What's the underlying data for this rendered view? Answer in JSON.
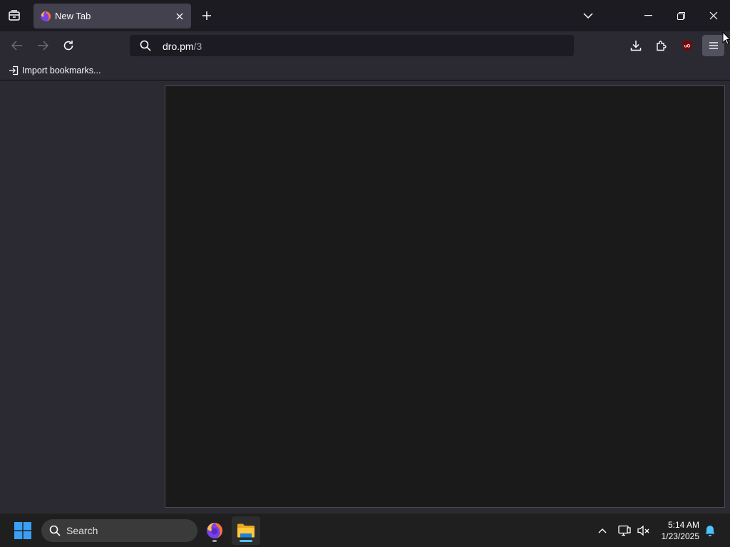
{
  "browser": {
    "tabs": [
      {
        "title": "New Tab"
      }
    ],
    "urlbar": {
      "host": "dro.pm",
      "path": "/3"
    },
    "bookmarks": {
      "import_label": "Import bookmarks..."
    },
    "extensions": {
      "ublock_badge": "uO"
    }
  },
  "taskbar": {
    "search_label": "Search",
    "clock": {
      "time": "5:14 AM",
      "date": "1/23/2025"
    }
  },
  "colors": {
    "accent": "#0078d4",
    "ublock_red": "#800000",
    "taskbar_indicator": "#4cc2ff"
  }
}
